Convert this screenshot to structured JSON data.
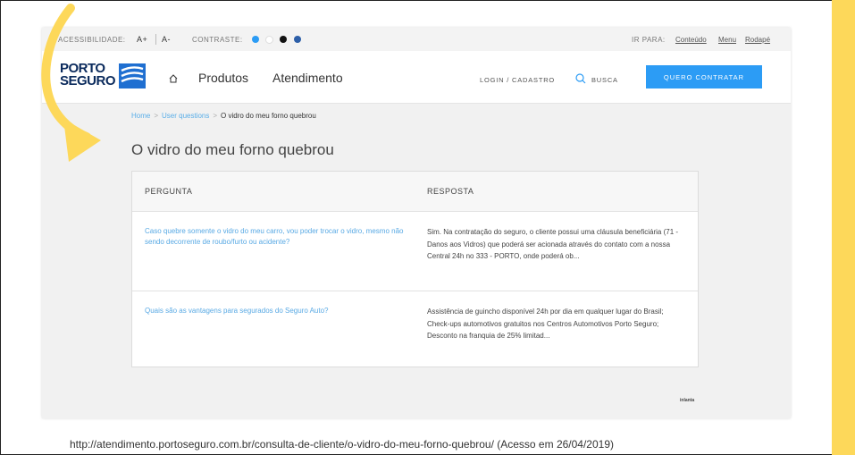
{
  "accessibility": {
    "label": "Acessibilidade:",
    "font_increase": "A+",
    "font_decrease": "A-",
    "contrast_label": "Contraste:",
    "contrast_colors": [
      "#2c9cf5",
      "#ffffff",
      "#111111",
      "#2d5fa8"
    ],
    "goto_label": "Ir para:",
    "goto_links": [
      "Conteúdo",
      "Menu",
      "Rodapé"
    ]
  },
  "header": {
    "logo_line1": "PORTO",
    "logo_line2": "SEGURO",
    "nav_items": [
      "Produtos",
      "Atendimento"
    ],
    "login": "Login / Cadastro",
    "search": "Busca",
    "cta": "Quero Contratar"
  },
  "breadcrumb": {
    "home": "Home",
    "section": "User questions",
    "current": "O vidro do meu forno quebrou"
  },
  "page_title": "O vidro do meu forno quebrou",
  "qa_table": {
    "headers": [
      "Pergunta",
      "Resposta"
    ],
    "rows": [
      {
        "question": "Caso quebre somente o vidro do meu carro, vou poder trocar o vidro, mesmo não sendo decorrente de roubo/furto ou acidente?",
        "answer": "Sim. Na contratação do seguro, o cliente possui uma cláusula beneficiária (71 - Danos aos Vidros) que poderá ser acionada através do contato com a nossa Central 24h no 333 - PORTO, onde poderá ob..."
      },
      {
        "question": "Quais são as vantagens para segurados do Seguro Auto?",
        "answer": "Assistência de guincho disponível 24h por dia em qualquer lugar do Brasil; Check-ups automotivos gratuitos nos Centros Automotivos Porto Seguro; Desconto na franquia de 25% limitad..."
      }
    ]
  },
  "signature": "inlanta",
  "caption": "http://atendimento.portoseguro.com.br/consulta-de-cliente/o-vidro-do-meu-forno-quebrou/ (Acesso em 26/04/2019)",
  "colors": {
    "accent": "#2c9cf5",
    "highlight": "#fdd85a",
    "brand": "#0a2a5c"
  }
}
